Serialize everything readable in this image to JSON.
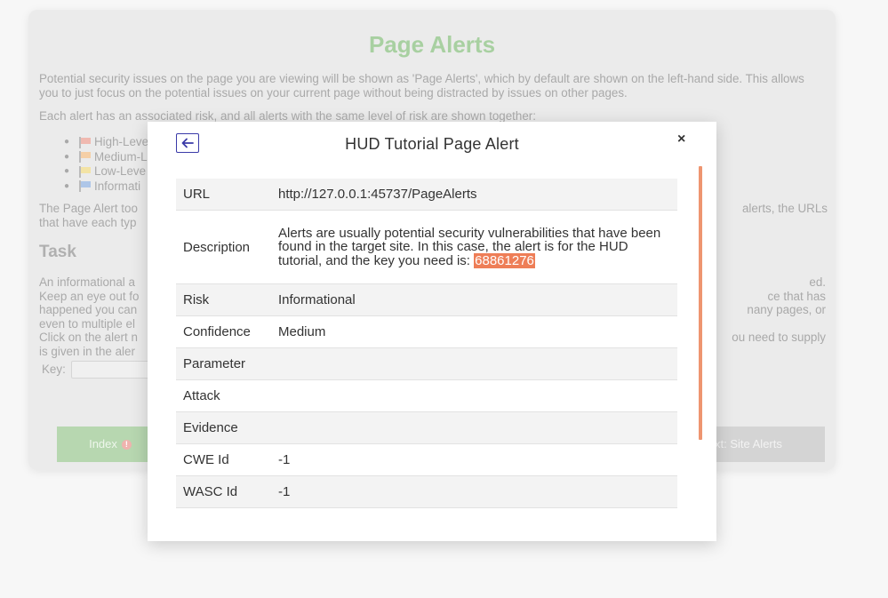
{
  "background_page": {
    "title": "Page Alerts",
    "intro": "Potential security issues on the page you are viewing will be shown as 'Page Alerts', which by default are shown on the left-hand side. This allows you to just focus on the potential issues on your current page without being distracted by issues on other pages.",
    "each_alert": "Each alert has an associated risk, and all alerts with the same level of risk are shown together:",
    "risk_items": [
      "High-Leve",
      "Medium-L",
      "Low-Leve",
      "Informati"
    ],
    "toolbar_left_1": "The Page Alert too",
    "toolbar_left_2": "that have each typ",
    "toolbar_right": "alerts, the URLs",
    "task_heading": "Task",
    "task_left": [
      "An informational a",
      "Keep an eye out fo",
      "happened you can",
      "even to multiple el",
      "Click on the alert n",
      "is given in the aler"
    ],
    "task_right": [
      "ed.",
      "ce that has",
      "nany pages, or",
      "",
      "ou need to supply",
      ""
    ],
    "key_label": "Key:",
    "index_button": "Index",
    "index_badge": "!",
    "next_button": "xt: Site Alerts"
  },
  "dialog": {
    "title": "HUD Tutorial Page Alert",
    "back_icon": "arrow-left-icon",
    "close_label": "×",
    "accent_color": "#ee7e57",
    "link_color": "#3f3fc6",
    "rows": {
      "url_label": "URL",
      "url_value": "http://127.0.0.1:45737/PageAlerts",
      "description_label": "Description",
      "description_value": "Alerts are usually potential security vulnerabilities that have been found in the target site. In this case, the alert is for the HUD tutorial, and the key you need is:",
      "description_key": "68861276",
      "risk_label": "Risk",
      "risk_value": "Informational",
      "confidence_label": "Confidence",
      "confidence_value": "Medium",
      "parameter_label": "Parameter",
      "parameter_value": "",
      "attack_label": "Attack",
      "attack_value": "",
      "evidence_label": "Evidence",
      "evidence_value": "",
      "cwe_label": "CWE Id",
      "cwe_value": "-1",
      "wasc_label": "WASC Id",
      "wasc_value": "-1"
    }
  }
}
